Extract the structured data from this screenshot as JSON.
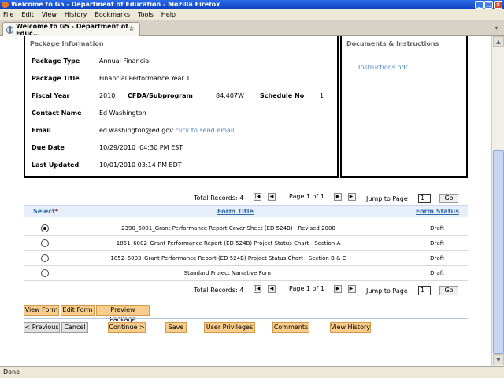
{
  "window": {
    "title": "Welcome to G5 - Department of Education - Mozilla Firefox"
  },
  "menu": [
    "File",
    "Edit",
    "View",
    "History",
    "Bookmarks",
    "Tools",
    "Help"
  ],
  "tab": {
    "label": "Welcome to G5 - Department of Educ...",
    "new_tab": "+"
  },
  "package": {
    "section_title": "Package Information",
    "type_label": "Package Type",
    "type_value": "Annual Financial",
    "title_label": "Package Title",
    "title_value": "Financial Performance Year 1",
    "fiscal_label": "Fiscal Year",
    "fiscal_value": "2010",
    "cfda_label": "CFDA/Subprogram",
    "cfda_value": "84.407W",
    "schedule_label": "Schedule No",
    "schedule_value": "1",
    "contact_label": "Contact Name",
    "contact_value": "Ed Washington",
    "email_label": "Email",
    "email_value": "ed.washington@ed.gov",
    "email_link": "click to send email",
    "due_label": "Due Date",
    "due_value": "10/29/2010  04:30 PM EST",
    "updated_label": "Last Updated",
    "updated_value": "10/01/2010 03:14 PM EDT"
  },
  "documents": {
    "section_title": "Documents & Instructions",
    "file": "Instructions.pdf"
  },
  "pager": {
    "total": "Total Records: 4",
    "page": "Page 1 of 1",
    "jump_label": "Jump to Page",
    "jump_value": "1",
    "go": "Go"
  },
  "table": {
    "col_select": "Select",
    "col_required": "*",
    "col_title": "Form Title",
    "col_status": "Form Status",
    "rows": [
      {
        "title": "2390_6001_Grant Performance Report Cover Sheet (ED 524B) - Revised 2008",
        "status": "Draft",
        "selected": true
      },
      {
        "title": "1851_6002_Grant Performance Report (ED 524B) Project Status Chart - Section A",
        "status": "Draft",
        "selected": false
      },
      {
        "title": "1852_6003_Grant Performance Report (ED 524B) Project Status Chart - Section B & C",
        "status": "Draft",
        "selected": false
      },
      {
        "title": "Standard Project Narrative Form",
        "status": "Draft",
        "selected": false
      }
    ]
  },
  "actions": {
    "view_form": "View Form",
    "edit_form": "Edit Form",
    "preview": "Preview Package"
  },
  "nav": {
    "previous": "< Previous",
    "cancel": "Cancel",
    "continue": "Continue >",
    "save": "Save",
    "privileges": "User Privileges",
    "comments": "Comments",
    "history": "View History"
  },
  "status_bar": "Done"
}
